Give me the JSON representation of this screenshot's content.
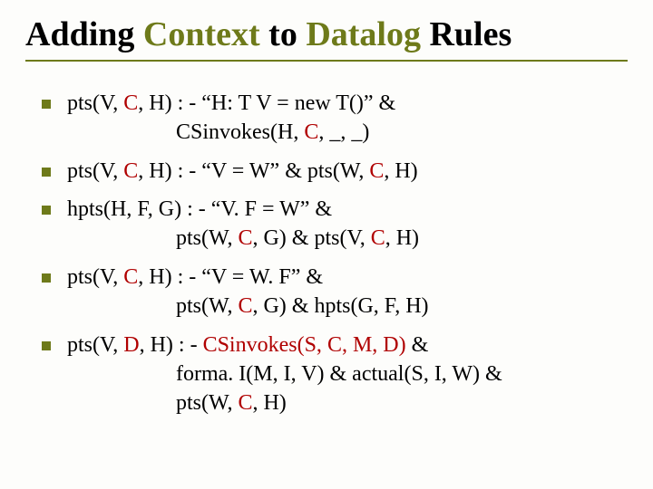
{
  "title": {
    "word1": "Adding",
    "word2": "Context",
    "word3": "to",
    "word4": "Datalog",
    "word5": "Rules"
  },
  "bullets": [
    {
      "pre1": "pts(V, ",
      "red1": "C",
      "post1": ", H) : - “H: T V = new T()” &",
      "cont_pre": "CSinvokes(H, ",
      "cont_red": "C",
      "cont_post": ", _, _)"
    },
    {
      "pre1": "pts(V, ",
      "red1": "C",
      "mid1": ", H) : - “V = W” & pts(W, ",
      "red2": "C",
      "post1": ", H)"
    },
    {
      "line1": "hpts(H, F, G) : - “V. F = W” &",
      "cont_pre": "pts(W, ",
      "cont_red1": "C",
      "cont_mid": ", G) & pts(V, ",
      "cont_red2": "C",
      "cont_post": ", H)"
    },
    {
      "pre1": "pts(V, ",
      "red1": "C",
      "post1": ", H) : - “V = W. F” &",
      "cont_pre": "pts(W, ",
      "cont_red1": "C",
      "cont_post": ", G) & hpts(G, F, H)"
    },
    {
      "pre1": "pts(V, ",
      "red1": "D",
      "mid1": ", H) : - ",
      "mid_pre": "CSinvokes(S, ",
      "red2": "C",
      "mid_mid": ", M, ",
      "red3": "D",
      "mid_post": ")",
      "post1": " &",
      "cont1": "forma. I(M, I, V) & actual(S, I, W) &",
      "cont2_pre": "pts(W, ",
      "cont2_red": "C",
      "cont2_post": ", H)"
    }
  ]
}
